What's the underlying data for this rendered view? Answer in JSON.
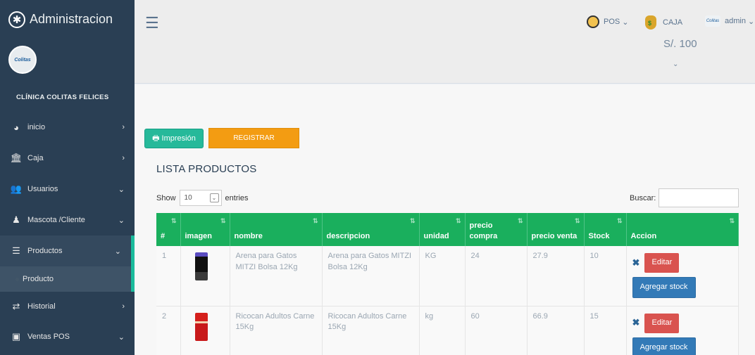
{
  "app": {
    "title": "Administracion",
    "clinic": "CLÍNICA COLITAS FELICES",
    "avatar_text": "Colitas"
  },
  "sidebar": {
    "items": [
      {
        "label": "inicio",
        "icon": "dashboard-icon",
        "chevron": "›"
      },
      {
        "label": "Caja",
        "icon": "bank-icon",
        "chevron": "›"
      },
      {
        "label": "Usuarios",
        "icon": "users-icon",
        "chevron": "⌄"
      },
      {
        "label": "Mascota /Cliente",
        "icon": "user-tie-icon",
        "chevron": "⌄"
      },
      {
        "label": "Productos",
        "icon": "database-icon",
        "chevron": "⌄"
      },
      {
        "label": "Historial",
        "icon": "exchange-icon",
        "chevron": "›"
      },
      {
        "label": "Ventas POS",
        "icon": "money-icon",
        "chevron": "⌄"
      }
    ],
    "submenu": {
      "label": "Producto"
    }
  },
  "topbar": {
    "pos_label": "POS",
    "caja_label": "CAJA",
    "caja_balance": "S/. 100",
    "admin_label": "admin",
    "chevron": "⌄"
  },
  "main": {
    "print_label": "Impresión",
    "register_label": "REGISTRAR",
    "list_title": "LISTA PRODUCTOS",
    "show_label": "Show",
    "page_size": "10",
    "entries_label": "entries",
    "search_label": "Buscar:"
  },
  "table": {
    "headers": [
      "#",
      "imagen",
      "nombre",
      "descripcion",
      "unidad",
      "precio compra",
      "precio venta",
      "Stock",
      "Accion"
    ],
    "rows": [
      {
        "num": "1",
        "nombre": "Arena para Gatos MITZI Bolsa 12Kg",
        "descripcion": "Arena para Gatos MITZI Bolsa 12Kg",
        "unidad": "KG",
        "precio_compra": "24",
        "precio_venta": "27.9",
        "stock": "10"
      },
      {
        "num": "2",
        "nombre": "Ricocan Adultos Carne 15Kg",
        "descripcion": "Ricocan Adultos Carne 15Kg",
        "unidad": "kg",
        "precio_compra": "60",
        "precio_venta": "66.9",
        "stock": "15"
      }
    ],
    "edit_label": "Editar",
    "stock_label": "Agregar stock"
  },
  "colors": {
    "sidebar": "#2a3f54",
    "table_header": "#1aaf5d",
    "register": "#f39c12",
    "edit": "#d9534f",
    "stock": "#337ab7"
  }
}
